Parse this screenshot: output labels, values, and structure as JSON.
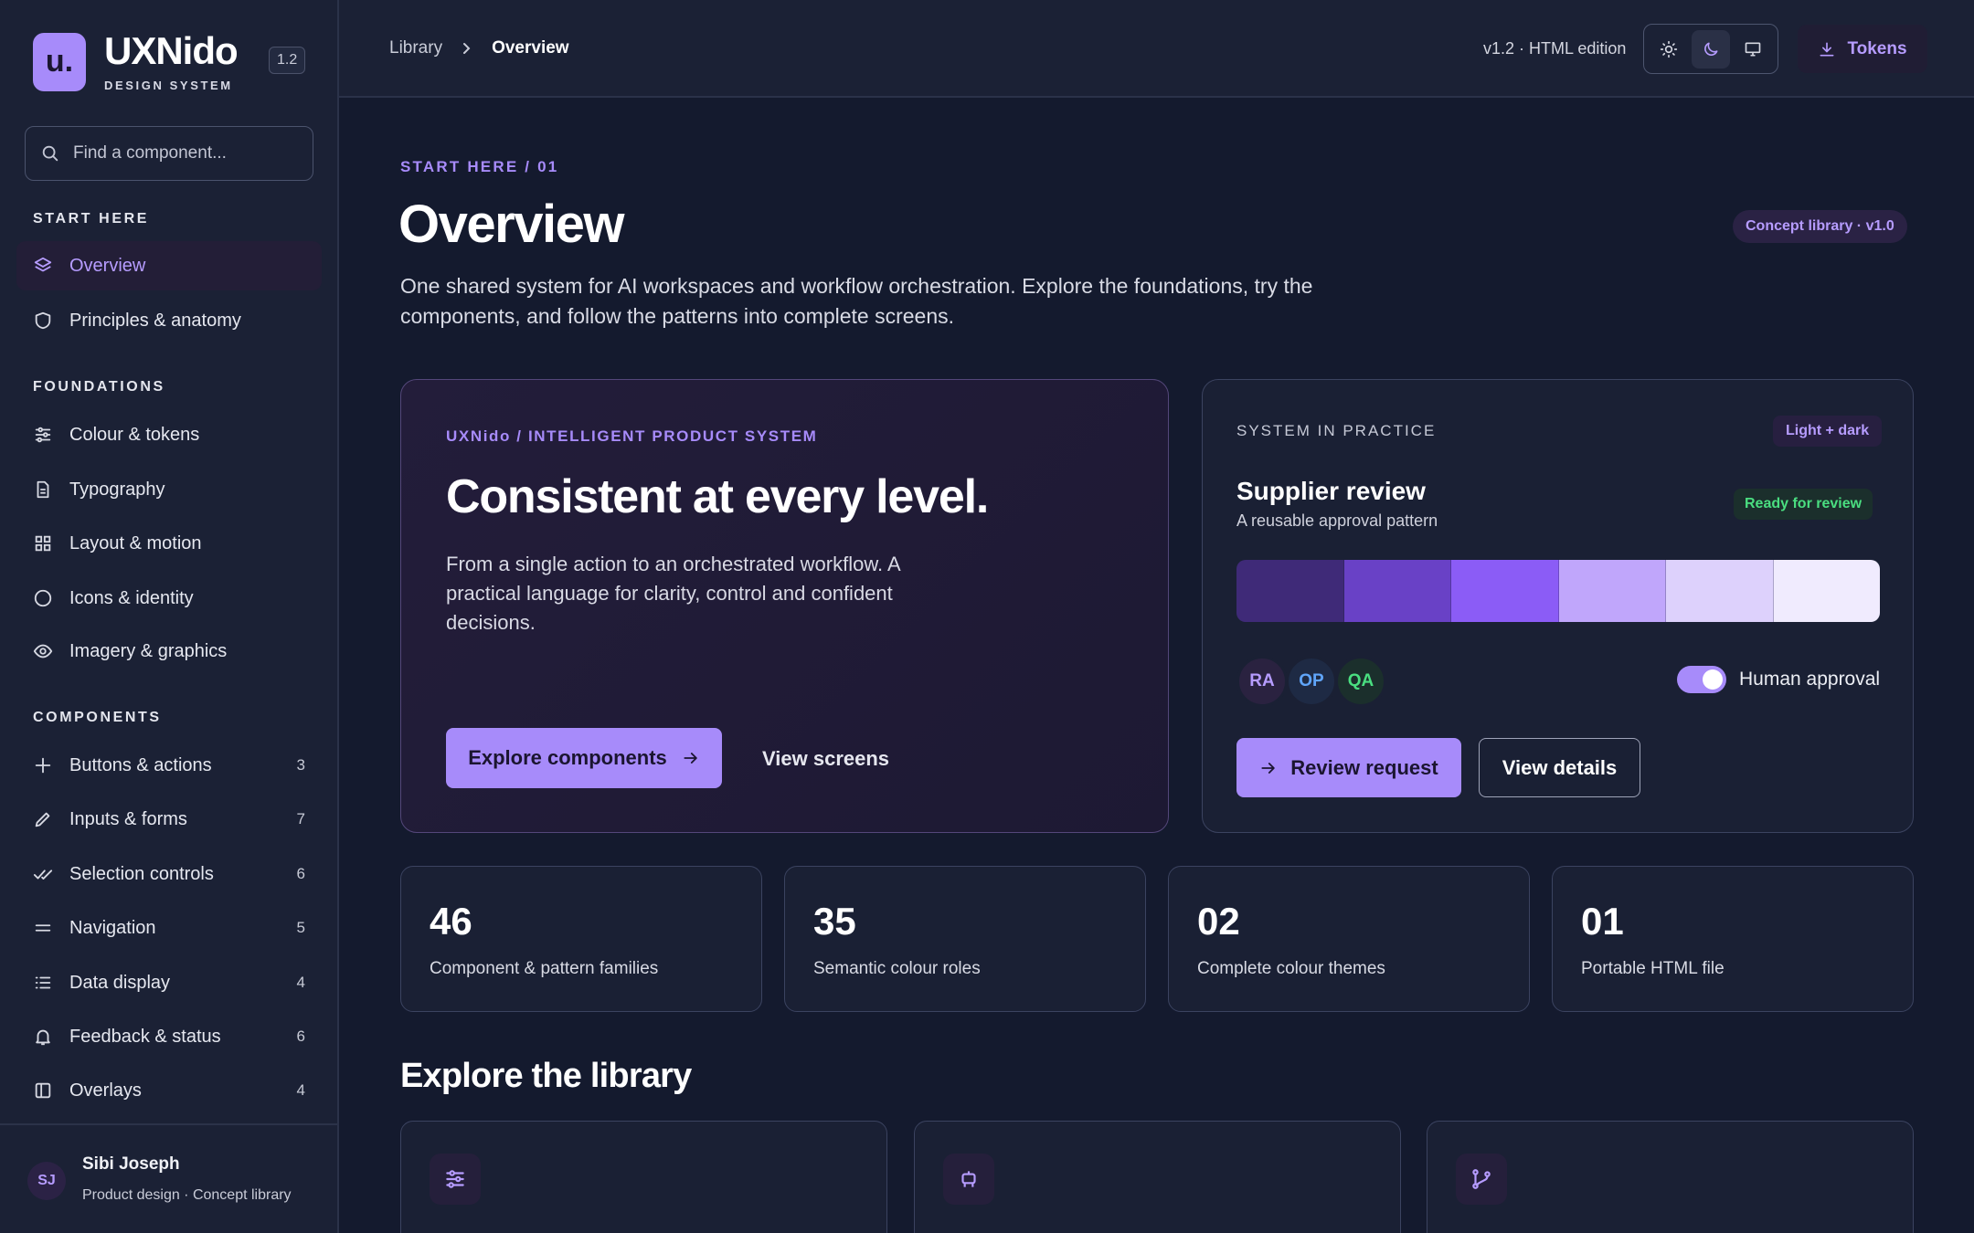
{
  "brand": {
    "logo": "u.",
    "name": "UXNido",
    "subtitle": "DESIGN SYSTEM",
    "version": "1.2"
  },
  "search": {
    "placeholder": "Find a component..."
  },
  "sidebar": {
    "sections": [
      {
        "title": "START HERE",
        "items": [
          {
            "label": "Overview",
            "icon": "layers-icon",
            "active": true
          },
          {
            "label": "Principles & anatomy",
            "icon": "shield-icon"
          }
        ]
      },
      {
        "title": "FOUNDATIONS",
        "items": [
          {
            "label": "Colour & tokens",
            "icon": "sliders-icon"
          },
          {
            "label": "Typography",
            "icon": "document-icon"
          },
          {
            "label": "Layout & motion",
            "icon": "grid-icon"
          },
          {
            "label": "Icons & identity",
            "icon": "circle-icon"
          },
          {
            "label": "Imagery & graphics",
            "icon": "eye-icon"
          }
        ]
      },
      {
        "title": "COMPONENTS",
        "items": [
          {
            "label": "Buttons & actions",
            "icon": "plus-icon",
            "count": "3"
          },
          {
            "label": "Inputs & forms",
            "icon": "pencil-icon",
            "count": "7"
          },
          {
            "label": "Selection controls",
            "icon": "double-check-icon",
            "count": "6"
          },
          {
            "label": "Navigation",
            "icon": "menu-icon",
            "count": "5"
          },
          {
            "label": "Data display",
            "icon": "list-icon",
            "count": "4"
          },
          {
            "label": "Feedback & status",
            "icon": "bell-icon",
            "count": "6"
          },
          {
            "label": "Overlays",
            "icon": "panel-icon",
            "count": "4"
          }
        ]
      }
    ]
  },
  "user": {
    "initials": "SJ",
    "name": "Sibi Joseph",
    "role": "Product design · Concept library"
  },
  "topbar": {
    "breadcrumb": [
      "Library",
      "Overview"
    ],
    "edition": "v1.2 · HTML edition",
    "theme_modes": [
      "sun-icon",
      "moon-icon",
      "monitor-icon"
    ],
    "active_theme": "moon-icon",
    "tokens_label": "Tokens"
  },
  "page": {
    "eyebrow": "START HERE / 01",
    "title": "Overview",
    "badge": "Concept library · v1.0",
    "intro": "One shared system for AI workspaces and workflow orchestration. Explore the foundations, try the components, and follow the patterns into complete screens."
  },
  "hero": {
    "eyebrow": "UXNido / INTELLIGENT PRODUCT SYSTEM",
    "title": "Consistent at every level.",
    "body": "From a single action to an orchestrated workflow. A practical language for clarity, control and confident decisions.",
    "primary_label": "Explore components",
    "secondary_label": "View screens"
  },
  "practice": {
    "eyebrow": "SYSTEM IN PRACTICE",
    "theme_pill": "Light + dark",
    "title": "Supplier review",
    "subtitle": "A reusable approval pattern",
    "status": "Ready for review",
    "swatches": [
      "#3f2a78",
      "#6941c6",
      "#8b5cf6",
      "#c0a6fb",
      "#ddd1fc",
      "#f0ebfe"
    ],
    "reviewers": [
      {
        "initials": "RA",
        "color": "#b69cff",
        "bg": "#2a2240"
      },
      {
        "initials": "OP",
        "color": "#60a5fa",
        "bg": "#1e2a44"
      },
      {
        "initials": "QA",
        "color": "#4ade80",
        "bg": "#1b2f2c"
      }
    ],
    "toggle_label": "Human approval",
    "toggle_on": true,
    "review_label": "Review request",
    "details_label": "View details"
  },
  "stats": [
    {
      "value": "46",
      "label": "Component & pattern families"
    },
    {
      "value": "35",
      "label": "Semantic colour roles"
    },
    {
      "value": "02",
      "label": "Complete colour themes"
    },
    {
      "value": "01",
      "label": "Portable HTML file"
    }
  ],
  "library": {
    "title": "Explore the library",
    "cards": [
      {
        "icon": "sliders-icon"
      },
      {
        "icon": "robot-icon"
      },
      {
        "icon": "git-branch-icon"
      }
    ]
  },
  "colors": {
    "accent": "#a78bfa",
    "background": "#141a2e",
    "sidebar": "#1b2135",
    "success": "#4ade80"
  }
}
